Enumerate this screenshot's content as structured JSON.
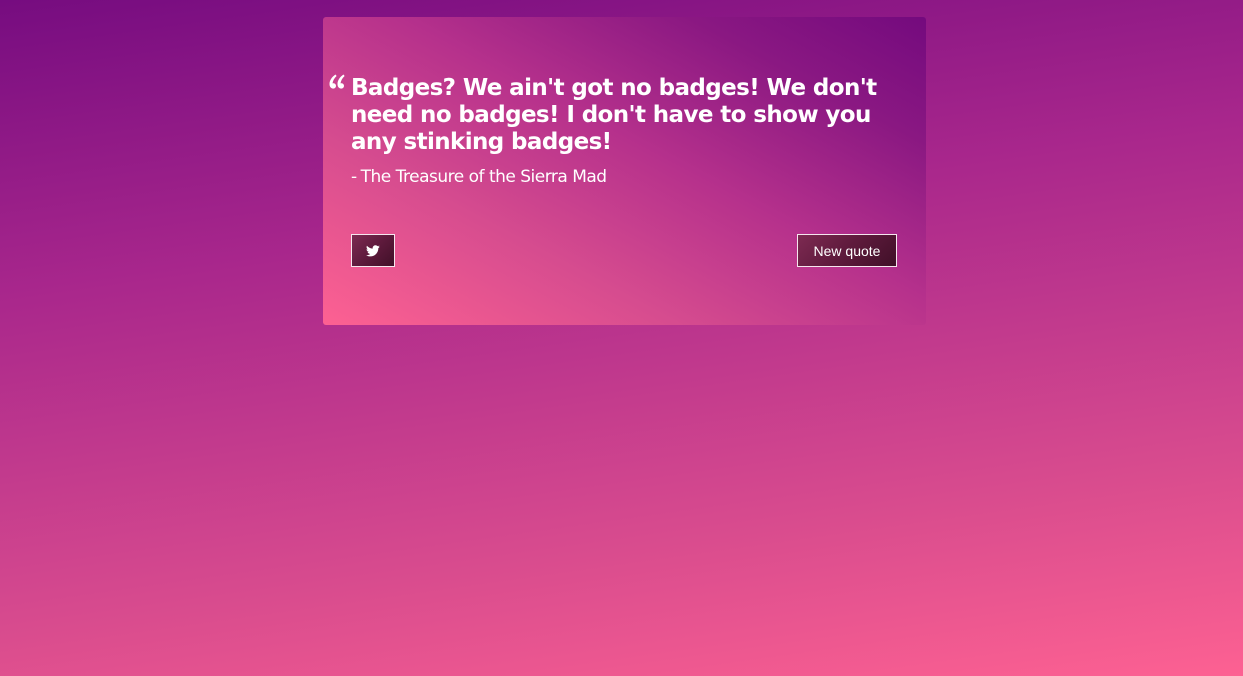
{
  "quote": {
    "mark_icon": "left-double-quote-icon",
    "text": "Badges? We ain't got no badges! We don't need no badges! I don't have to show you any stinking badges!",
    "author_prefix": "-",
    "author": "The Treasure of the Sierra Mad"
  },
  "actions": {
    "tweet_icon": "twitter-icon",
    "new_quote_label": "New quote"
  },
  "colors": {
    "background_top": "#760c80",
    "background_bottom": "#fd6192",
    "button_dark": "#5e1a3c",
    "text": "#ffffff"
  }
}
